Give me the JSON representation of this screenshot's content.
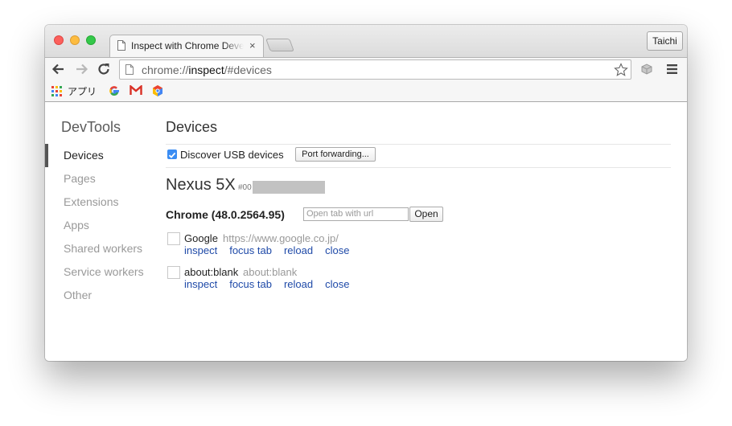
{
  "tab": {
    "title": "Inspect with Chrome Developer Tools",
    "close": "×"
  },
  "profile": {
    "name": "Taichi"
  },
  "omnibox": {
    "scheme": "chrome://",
    "host": "inspect",
    "path": "/#devices"
  },
  "bookmarks": {
    "apps_label": "アプリ"
  },
  "sidebar": {
    "title": "DevTools",
    "items": [
      {
        "label": "Devices",
        "selected": true
      },
      {
        "label": "Pages",
        "selected": false
      },
      {
        "label": "Extensions",
        "selected": false
      },
      {
        "label": "Apps",
        "selected": false
      },
      {
        "label": "Shared workers",
        "selected": false
      },
      {
        "label": "Service workers",
        "selected": false
      },
      {
        "label": "Other",
        "selected": false
      }
    ]
  },
  "main": {
    "title": "Devices",
    "discover_usb": {
      "label": "Discover USB devices",
      "checked": true
    },
    "port_forwarding_label": "Port forwarding...",
    "device": {
      "name": "Nexus 5X",
      "serial_prefix": "#00",
      "browser": "Chrome (48.0.2564.95)",
      "open_placeholder": "Open tab with url",
      "open_label": "Open",
      "pages": [
        {
          "title": "Google",
          "url": "https://www.google.co.jp/"
        },
        {
          "title": "about:blank",
          "url": "about:blank"
        }
      ],
      "actions": [
        "inspect",
        "focus tab",
        "reload",
        "close"
      ]
    }
  },
  "colors": {
    "link": "#1f4aa8",
    "checkbox": "#3b8df3",
    "selected_bar": "#555555"
  }
}
